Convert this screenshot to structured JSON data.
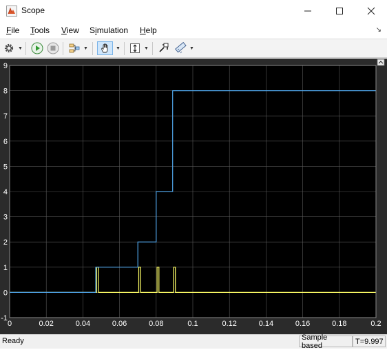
{
  "window": {
    "title": "Scope"
  },
  "menu": {
    "items": [
      {
        "label": "File",
        "mnemonic": "F",
        "rest": "ile"
      },
      {
        "label": "Tools",
        "mnemonic": "T",
        "rest": "ools"
      },
      {
        "label": "View",
        "mnemonic": "V",
        "rest": "iew"
      },
      {
        "label": "Simulation",
        "mnemonic": "i",
        "pre": "S",
        "rest": "mulation"
      },
      {
        "label": "Help",
        "mnemonic": "H",
        "rest": "elp"
      }
    ]
  },
  "toolbar": {
    "icons": [
      "gear-icon",
      "run-icon",
      "stop-icon",
      "signal-selector-icon",
      "pan-icon",
      "scale-axes-icon",
      "highlight-icon",
      "measurement-icon"
    ]
  },
  "colors": {
    "plot_bg": "#000000",
    "figure_bg": "#2b2b2b",
    "grid": "#5a5a5a",
    "axis_text": "#ffffff",
    "series_1": "#4fa3e6",
    "series_2": "#ffff66"
  },
  "chart_data": {
    "type": "line",
    "title": "",
    "xlabel": "",
    "ylabel": "",
    "xlim": [
      0,
      0.2
    ],
    "ylim": [
      -1,
      9
    ],
    "grid": true,
    "x_ticks": [
      "0",
      "0.02",
      "0.04",
      "0.06",
      "0.08",
      "0.1",
      "0.12",
      "0.14",
      "0.16",
      "0.18",
      "0.2"
    ],
    "y_ticks": [
      "-1",
      "0",
      "1",
      "2",
      "3",
      "4",
      "5",
      "6",
      "7",
      "8",
      "9"
    ],
    "series": [
      {
        "color": "#4fa3e6",
        "step": true,
        "x": [
          0,
          0.047,
          0.047,
          0.07,
          0.07,
          0.08,
          0.08,
          0.089,
          0.089,
          0.2
        ],
        "y": [
          0,
          0,
          1,
          1,
          2,
          2,
          4,
          4,
          8,
          8
        ]
      },
      {
        "color": "#ffff66",
        "step": true,
        "x": [
          0,
          0.0475,
          0.0475,
          0.0485,
          0.0485,
          0.0705,
          0.0705,
          0.0715,
          0.0715,
          0.0805,
          0.0805,
          0.0815,
          0.0815,
          0.0895,
          0.0895,
          0.0905,
          0.0905,
          0.2
        ],
        "y": [
          0,
          0,
          1,
          1,
          0,
          0,
          1,
          1,
          0,
          0,
          1,
          1,
          0,
          0,
          1,
          1,
          0,
          0
        ]
      }
    ]
  },
  "status": {
    "ready": "Ready",
    "sample_mode": "Sample based",
    "time": "T=9.997"
  }
}
